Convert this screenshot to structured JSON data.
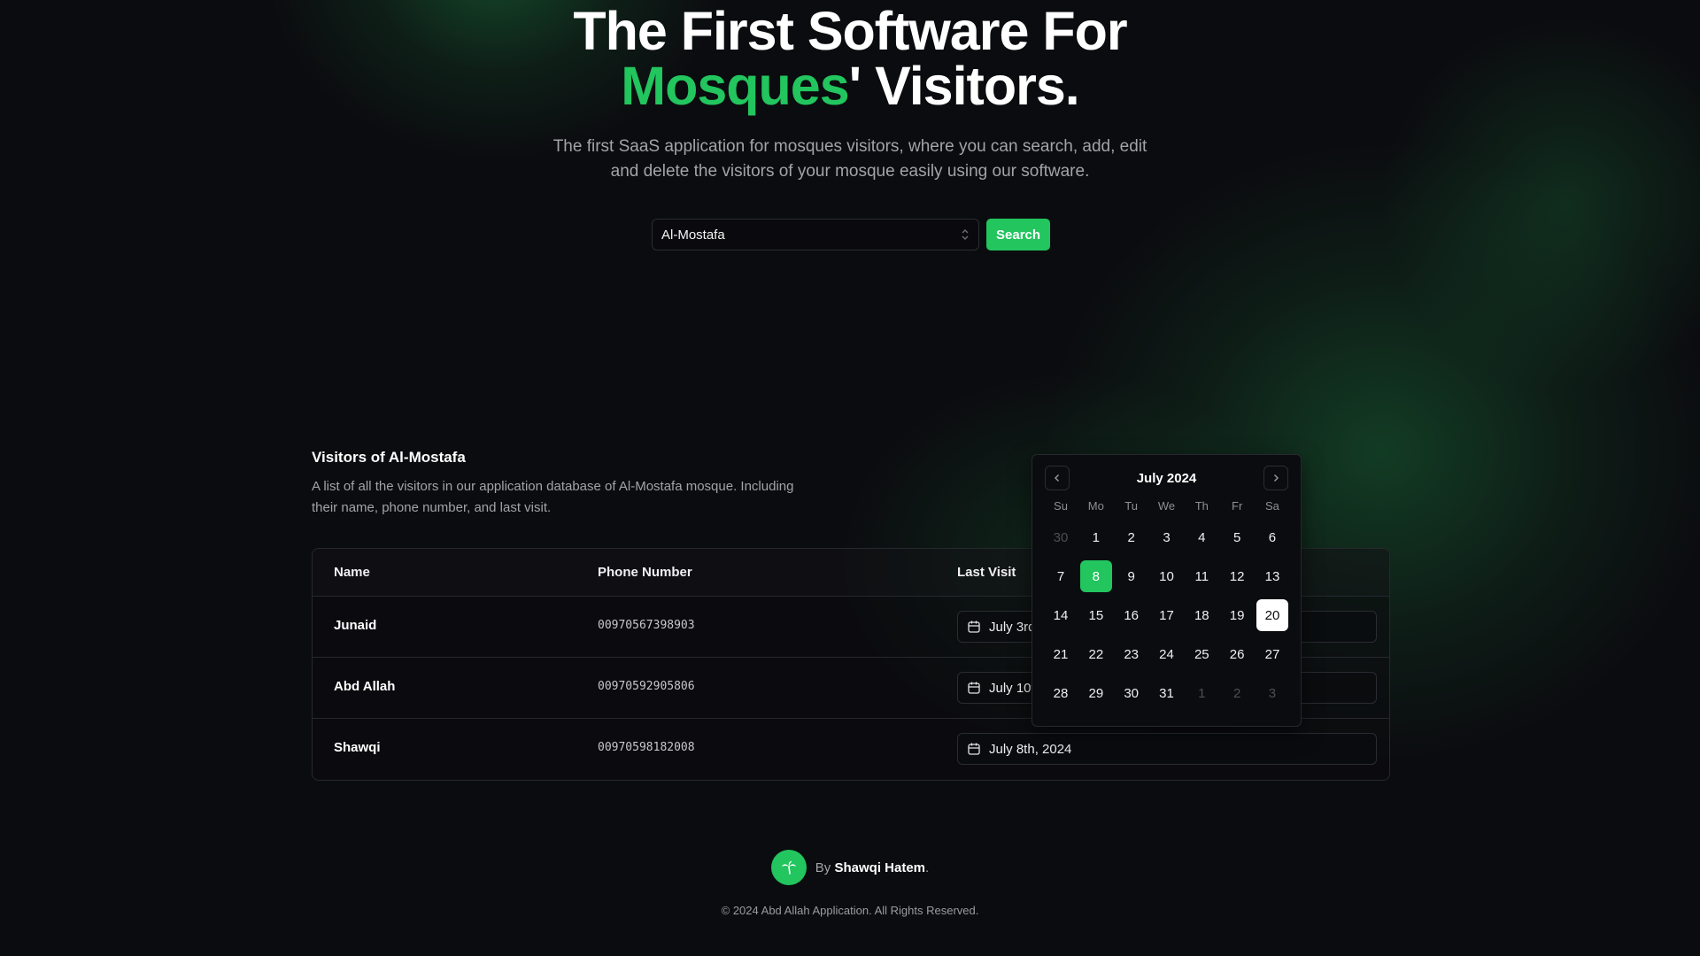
{
  "hero": {
    "title_line1": "The First Software For",
    "title_accent": "Mosques",
    "title_line2_rest": "' Visitors.",
    "subtitle": "The first SaaS application for mosques visitors, where you can search, add, edit and delete the visitors of your mosque easily using our software."
  },
  "search": {
    "selected_mosque": "Al-Mostafa",
    "button_label": "Search"
  },
  "section": {
    "title": "Visitors of Al-Mostafa",
    "description": "A list of all the visitors in our application database of Al-Mostafa mosque. Including their name, phone number, and last visit."
  },
  "table": {
    "headers": [
      "Name",
      "Phone Number",
      "Last Visit"
    ],
    "rows": [
      {
        "name": "Junaid",
        "phone": "00970567398903",
        "last_visit": "July 3rd, 2024"
      },
      {
        "name": "Abd Allah",
        "phone": "00970592905806",
        "last_visit": "July 10th, 2024"
      },
      {
        "name": "Shawqi",
        "phone": "00970598182008",
        "last_visit": "July 8th, 2024"
      }
    ]
  },
  "calendar": {
    "caption": "July 2024",
    "weekdays": [
      "Su",
      "Mo",
      "Tu",
      "We",
      "Th",
      "Fr",
      "Sa"
    ],
    "weeks": [
      [
        "30",
        "1",
        "2",
        "3",
        "4",
        "5",
        "6"
      ],
      [
        "7",
        "8",
        "9",
        "10",
        "11",
        "12",
        "13"
      ],
      [
        "14",
        "15",
        "16",
        "17",
        "18",
        "19",
        "20"
      ],
      [
        "21",
        "22",
        "23",
        "24",
        "25",
        "26",
        "27"
      ],
      [
        "28",
        "29",
        "30",
        "31",
        "1",
        "2",
        "3"
      ]
    ],
    "selected_day": "8",
    "today_day": "20"
  },
  "footer": {
    "by_prefix": "By",
    "author": "Shawqi Hatem",
    "by_suffix": ".",
    "copyright": "© 2024 Abd Allah Application. All Rights Reserved."
  },
  "colors": {
    "accent": "#22c55e",
    "background": "#0b0c0f",
    "border": "#26282d"
  },
  "icons": {
    "select": "chevron-up-down-icon",
    "date": "calendar-icon",
    "prev": "chevron-left-icon",
    "next": "chevron-right-icon",
    "logo": "palm-tree-icon"
  }
}
